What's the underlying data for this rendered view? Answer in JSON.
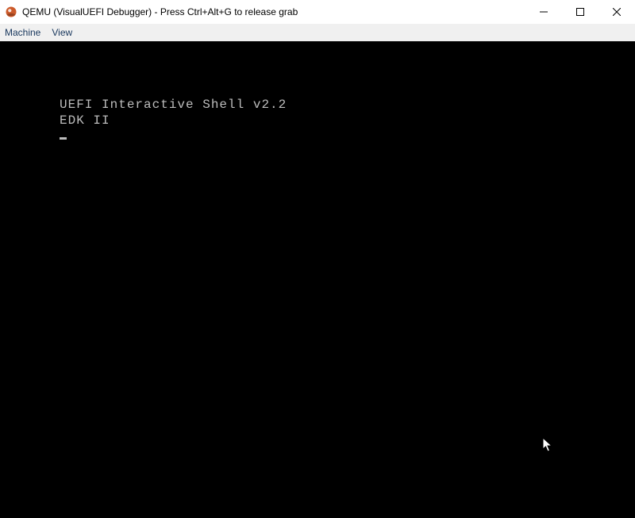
{
  "window": {
    "title": "QEMU (VisualUEFI Debugger) - Press Ctrl+Alt+G to release grab"
  },
  "menu": {
    "machine": "Machine",
    "view": "View"
  },
  "terminal": {
    "line1": "UEFI Interactive Shell v2.2",
    "line2": "EDK II"
  }
}
